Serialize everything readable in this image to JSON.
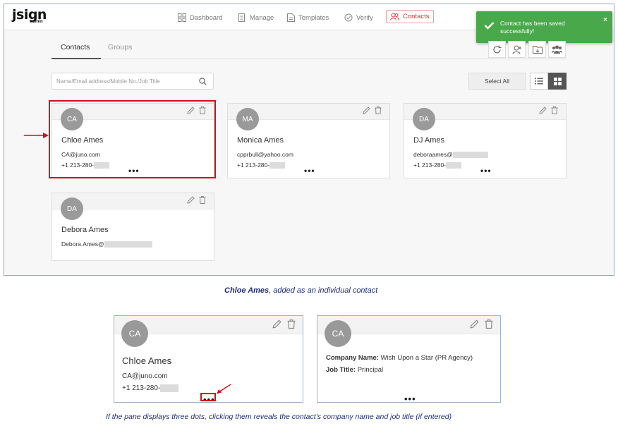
{
  "app": {
    "logo": "jsign",
    "logo_sub": "admin"
  },
  "nav": [
    {
      "label": "Dashboard",
      "icon": "dashboard-icon"
    },
    {
      "label": "Manage",
      "icon": "manage-icon"
    },
    {
      "label": "Templates",
      "icon": "templates-icon"
    },
    {
      "label": "Verify",
      "icon": "verify-icon"
    },
    {
      "label": "Contacts",
      "icon": "contacts-icon",
      "active": true
    }
  ],
  "toast": {
    "message": "Contact has been saved successfully!",
    "close": "×",
    "color": "#49a84a"
  },
  "tabs": [
    {
      "label": "Contacts",
      "active": true
    },
    {
      "label": "Groups"
    }
  ],
  "toolbar": {
    "icons": [
      "refresh-icon",
      "add-contact-icon",
      "import-folder-icon",
      "group-icon"
    ]
  },
  "search": {
    "placeholder": "Name/Email address/Mobile No./Job Title"
  },
  "select_all_label": "Select All",
  "contacts": [
    {
      "initials": "CA",
      "name": "Chloe Ames",
      "email": "CA@juno.com",
      "phone": "+1 213-280-",
      "has_more": true
    },
    {
      "initials": "MA",
      "name": "Monica Ames",
      "email": "cpprbull@yahoo.com",
      "phone": "+1 213-280-",
      "has_more": true
    },
    {
      "initials": "DA",
      "name": "DJ Ames",
      "email": "deboraames@",
      "phone": "+1 213-280-",
      "has_more": true
    },
    {
      "initials": "DA",
      "name": "Debora Ames",
      "email": "Debora.Ames@",
      "phone": "",
      "has_more": false
    }
  ],
  "caption1": {
    "bold": "Chloe Ames",
    "rest": ", added as an individual contact"
  },
  "detail_front": {
    "initials": "CA",
    "name": "Chloe Ames",
    "email": "CA@juno.com",
    "phone": "+1 213-280-",
    "dots": "•••"
  },
  "detail_back": {
    "initials": "CA",
    "company_label": "Company Name:",
    "company": "Wish Upon a Star (PR Agency)",
    "job_label": "Job Title:",
    "job": "Principal",
    "dots": "•••"
  },
  "caption2": "If the pane displays three dots, clicking them reveals the contact’s company name and job title (if entered)",
  "colors": {
    "highlight": "#d20f1a",
    "caption": "#1f2d79",
    "active_nav": "#dd3333"
  }
}
